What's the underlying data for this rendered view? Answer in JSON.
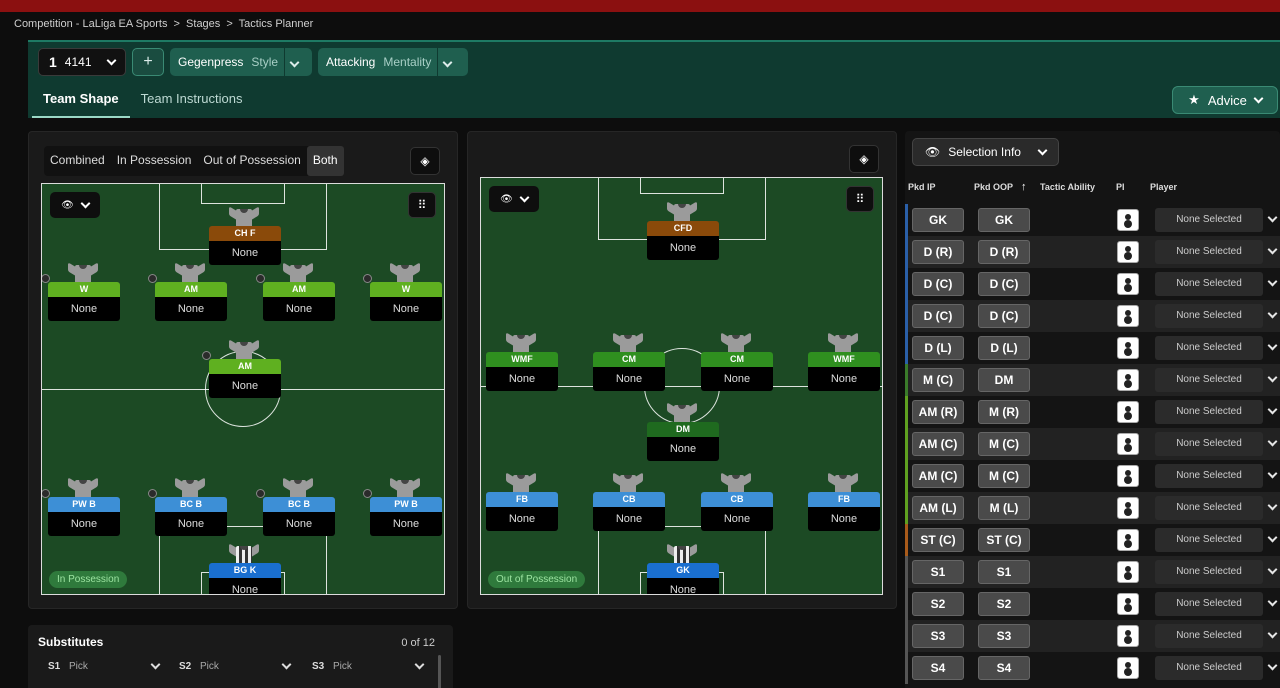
{
  "breadcrumb": [
    "Competition - LaLiga EA Sports",
    ">",
    "Stages",
    ">",
    "Tactics Planner"
  ],
  "tactic": {
    "slot": "1",
    "formation": "4141",
    "add": "+",
    "style_value": "Gegenpress",
    "style_label": "Style",
    "mentality_value": "Attacking",
    "mentality_label": "Mentality"
  },
  "tabs": [
    "Team Shape",
    "Team Instructions"
  ],
  "advice": "Advice",
  "phase_filter": [
    "Combined",
    "In Possession",
    "Out of Possession",
    "Both"
  ],
  "left_pitch": {
    "label": "In Possession",
    "players": [
      {
        "role": "CH F",
        "name": "None",
        "color": "#8a4a0a"
      },
      {
        "role": "W",
        "name": "None",
        "color": "#5fb020"
      },
      {
        "role": "AM",
        "name": "None",
        "color": "#5fb020"
      },
      {
        "role": "AM",
        "name": "None",
        "color": "#5fb020"
      },
      {
        "role": "W",
        "name": "None",
        "color": "#5fb020"
      },
      {
        "role": "AM",
        "name": "None",
        "color": "#5fb020"
      },
      {
        "role": "PW B",
        "name": "None",
        "color": "#3d8fd6"
      },
      {
        "role": "BC B",
        "name": "None",
        "color": "#3d8fd6"
      },
      {
        "role": "BC B",
        "name": "None",
        "color": "#3d8fd6"
      },
      {
        "role": "PW B",
        "name": "None",
        "color": "#3d8fd6"
      },
      {
        "role": "BG K",
        "name": "None",
        "color": "#1a6fd0"
      }
    ]
  },
  "right_pitch": {
    "label": "Out of Possession",
    "players": [
      {
        "role": "CFD",
        "name": "None",
        "color": "#8a4a0a"
      },
      {
        "role": "WMF",
        "name": "None",
        "color": "#2f8f1f"
      },
      {
        "role": "CM",
        "name": "None",
        "color": "#2f8f1f"
      },
      {
        "role": "CM",
        "name": "None",
        "color": "#2f8f1f"
      },
      {
        "role": "WMF",
        "name": "None",
        "color": "#2f8f1f"
      },
      {
        "role": "DM",
        "name": "None",
        "color": "#1f6a1f"
      },
      {
        "role": "FB",
        "name": "None",
        "color": "#3d8fd6"
      },
      {
        "role": "CB",
        "name": "None",
        "color": "#3d8fd6"
      },
      {
        "role": "CB",
        "name": "None",
        "color": "#3d8fd6"
      },
      {
        "role": "FB",
        "name": "None",
        "color": "#3d8fd6"
      },
      {
        "role": "GK",
        "name": "None",
        "color": "#1a6fd0"
      }
    ]
  },
  "selection_info": "Selection Info",
  "table": {
    "headers": [
      "Pkd IP",
      "Pkd OOP",
      "Tactic Ability",
      "PI",
      "Player"
    ],
    "rows": [
      {
        "ip": "GK",
        "oop": "GK",
        "player": "None Selected",
        "tag": "#2a5fa8"
      },
      {
        "ip": "D (R)",
        "oop": "D (R)",
        "player": "None Selected",
        "tag": "#2a5fa8"
      },
      {
        "ip": "D (C)",
        "oop": "D (C)",
        "player": "None Selected",
        "tag": "#2a5fa8"
      },
      {
        "ip": "D (C)",
        "oop": "D (C)",
        "player": "None Selected",
        "tag": "#2a5fa8"
      },
      {
        "ip": "D (L)",
        "oop": "D (L)",
        "player": "None Selected",
        "tag": "#2a5fa8"
      },
      {
        "ip": "M (C)",
        "oop": "DM",
        "player": "None Selected",
        "tag": "#3a7a2a"
      },
      {
        "ip": "AM (R)",
        "oop": "M (R)",
        "player": "None Selected",
        "tag": "#5fa020"
      },
      {
        "ip": "AM (C)",
        "oop": "M (C)",
        "player": "None Selected",
        "tag": "#5fa020"
      },
      {
        "ip": "AM (C)",
        "oop": "M (C)",
        "player": "None Selected",
        "tag": "#5fa020"
      },
      {
        "ip": "AM (L)",
        "oop": "M (L)",
        "player": "None Selected",
        "tag": "#5fa020"
      },
      {
        "ip": "ST (C)",
        "oop": "ST (C)",
        "player": "None Selected",
        "tag": "#a85a1a"
      },
      {
        "ip": "S1",
        "oop": "S1",
        "player": "None Selected",
        "tag": "#555"
      },
      {
        "ip": "S2",
        "oop": "S2",
        "player": "None Selected",
        "tag": "#555"
      },
      {
        "ip": "S3",
        "oop": "S3",
        "player": "None Selected",
        "tag": "#555"
      },
      {
        "ip": "S4",
        "oop": "S4",
        "player": "None Selected",
        "tag": "#555"
      }
    ]
  },
  "substitutes": {
    "title": "Substitutes",
    "count": "0 of 12",
    "slots": [
      {
        "id": "S1",
        "value": "Pick"
      },
      {
        "id": "S2",
        "value": "Pick"
      },
      {
        "id": "S3",
        "value": "Pick"
      }
    ]
  }
}
